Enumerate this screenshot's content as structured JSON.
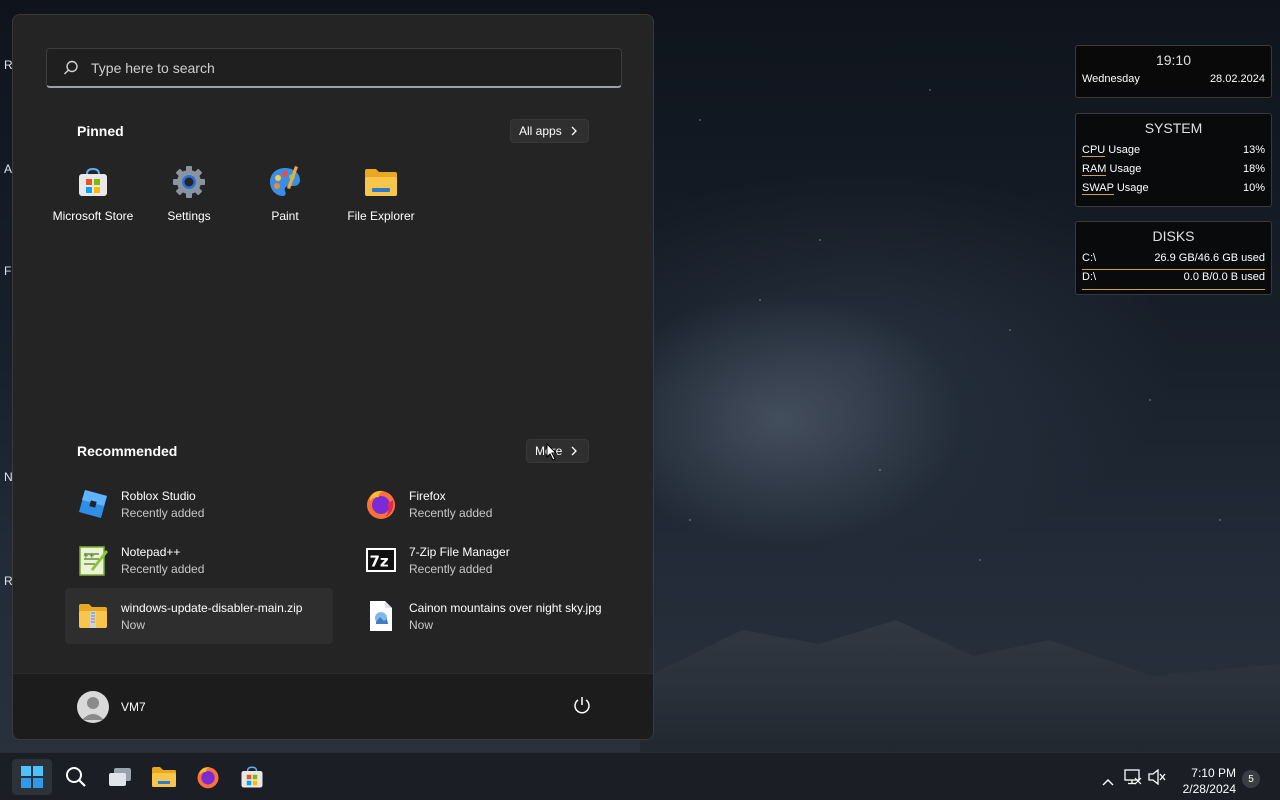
{
  "desktop": {
    "labels": [
      "R",
      "A",
      "Fi",
      "N",
      "Re"
    ]
  },
  "start_menu": {
    "search": {
      "placeholder": "Type here to search"
    },
    "pinned": {
      "title": "Pinned",
      "all_apps_label": "All apps",
      "apps": [
        {
          "label": "Microsoft Store",
          "icon": "store-icon"
        },
        {
          "label": "Settings",
          "icon": "gear-icon"
        },
        {
          "label": "Paint",
          "icon": "paint-icon"
        },
        {
          "label": "File Explorer",
          "icon": "folder-icon"
        }
      ]
    },
    "recommended": {
      "title": "Recommended",
      "more_label": "More",
      "items": [
        {
          "name": "Roblox Studio",
          "sub": "Recently added",
          "icon": "roblox-studio-icon"
        },
        {
          "name": "Firefox",
          "sub": "Recently added",
          "icon": "firefox-icon"
        },
        {
          "name": "Notepad++",
          "sub": "Recently added",
          "icon": "notepad-plus-plus-icon"
        },
        {
          "name": "7-Zip File Manager",
          "sub": "Recently added",
          "icon": "7zip-icon"
        },
        {
          "name": "windows-update-disabler-main.zip",
          "sub": "Now",
          "icon": "zip-folder-icon"
        },
        {
          "name": "Cainon mountains over night sky.jpg",
          "sub": "Now",
          "icon": "image-file-icon"
        }
      ]
    },
    "user": {
      "name": "VM7"
    }
  },
  "widgets": {
    "clock": {
      "time": "19:10",
      "day": "Wednesday",
      "date": "28.02.2024"
    },
    "system": {
      "title": "SYSTEM",
      "rows": [
        {
          "key": "CPU",
          "label": " Usage",
          "value": "13%"
        },
        {
          "key": "RAM",
          "label": " Usage",
          "value": "18%"
        },
        {
          "key": "SWAP",
          "label": " Usage",
          "value": "10%"
        }
      ]
    },
    "disks": {
      "title": "DISKS",
      "rows": [
        {
          "label": "C:\\",
          "value": "26.9 GB/46.6 GB used"
        },
        {
          "label": "D:\\",
          "value": "0.0 B/0.0 B used"
        }
      ]
    }
  },
  "taskbar": {
    "time": "7:10 PM",
    "date": "2/28/2024",
    "notification_count": "5",
    "colors": {
      "accent": "#0078d4",
      "folder": "#f3c13a"
    }
  }
}
